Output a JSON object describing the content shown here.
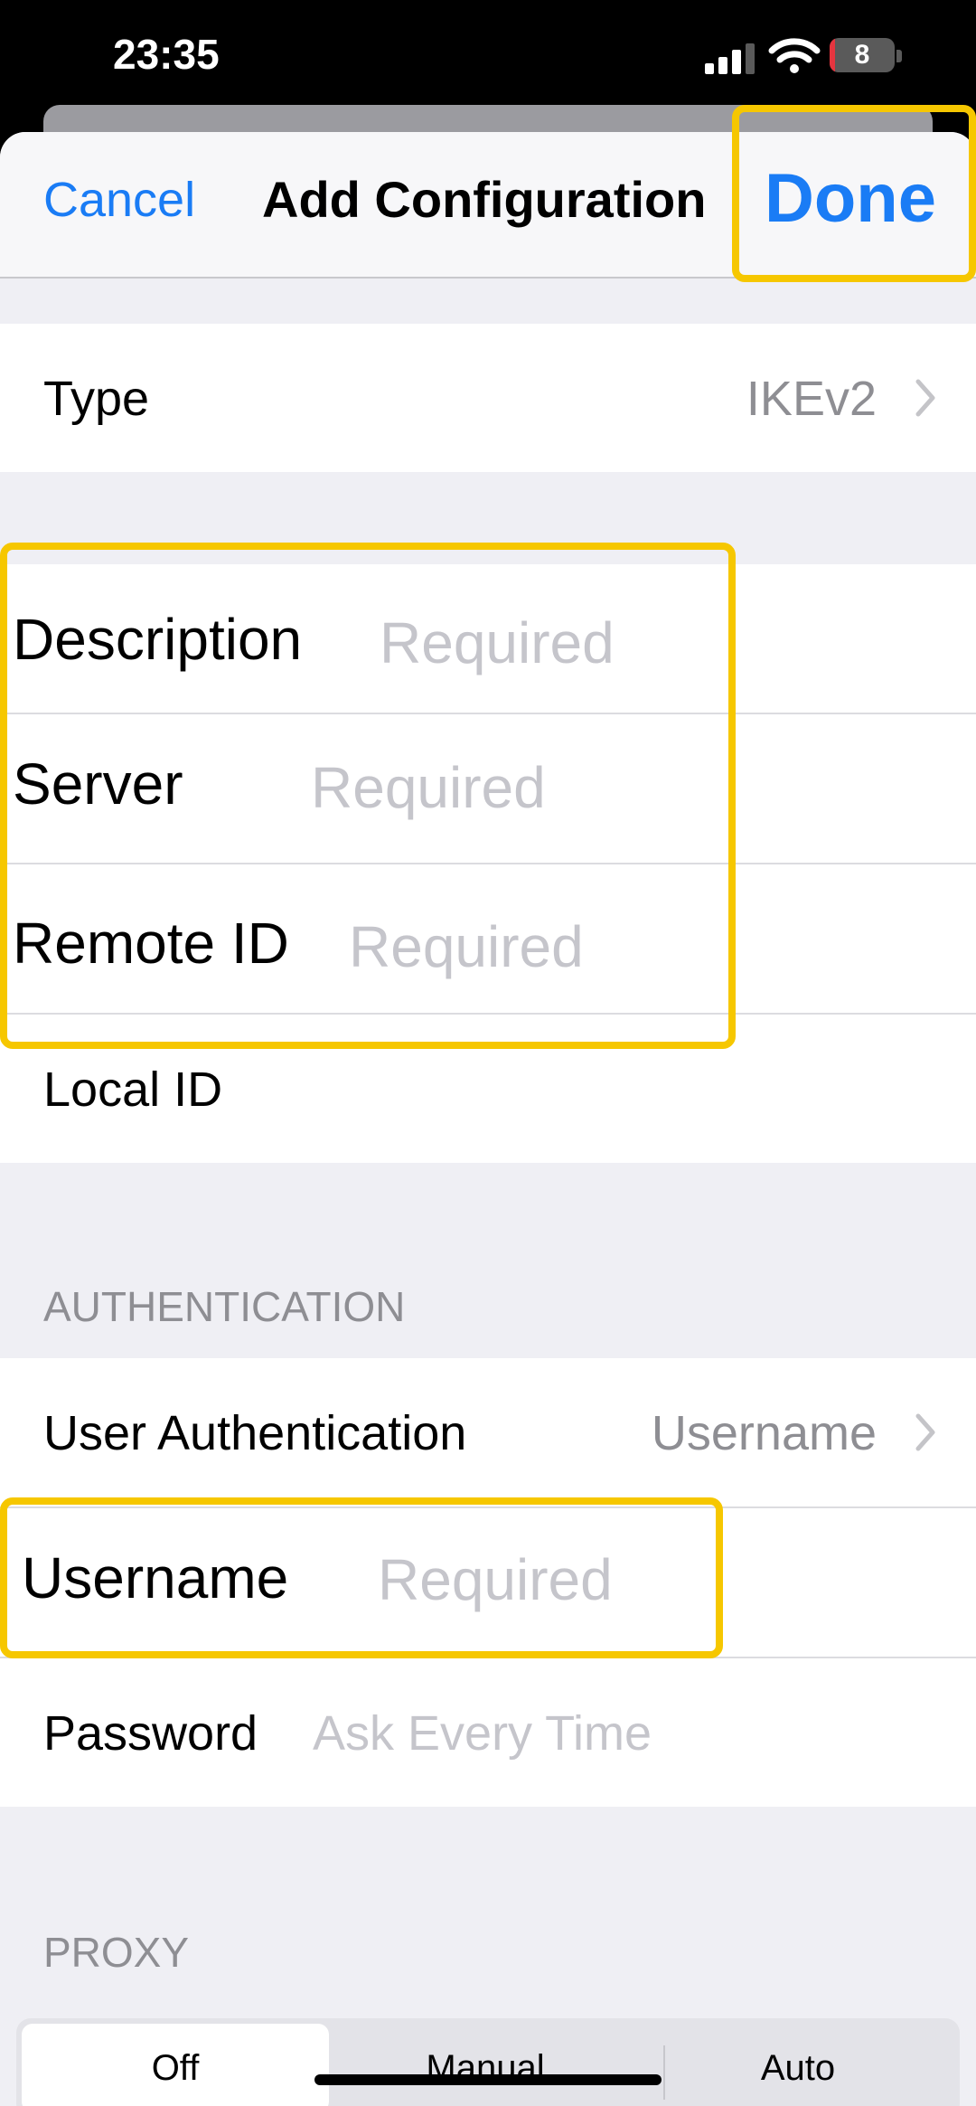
{
  "status_bar": {
    "time": "23:35",
    "battery": "8",
    "battery_level": 0.08
  },
  "nav": {
    "cancel": "Cancel",
    "title": "Add Configuration",
    "done": "Done"
  },
  "type_row": {
    "label": "Type",
    "value": "IKEv2"
  },
  "fields": {
    "description": {
      "label": "Description",
      "placeholder": "Required"
    },
    "server": {
      "label": "Server",
      "placeholder": "Required"
    },
    "remote_id": {
      "label": "Remote ID",
      "placeholder": "Required"
    },
    "local_id": {
      "label": "Local ID"
    }
  },
  "authentication": {
    "header": "AUTHENTICATION",
    "user_auth": {
      "label": "User Authentication",
      "value": "Username"
    },
    "username": {
      "label": "Username",
      "placeholder": "Required"
    },
    "password": {
      "label": "Password",
      "placeholder": "Ask Every Time"
    }
  },
  "proxy": {
    "header": "PROXY",
    "options": [
      "Off",
      "Manual",
      "Auto"
    ],
    "selected": "Off"
  },
  "colors": {
    "accent": "#1a7cf5",
    "highlight": "#f6c700"
  }
}
